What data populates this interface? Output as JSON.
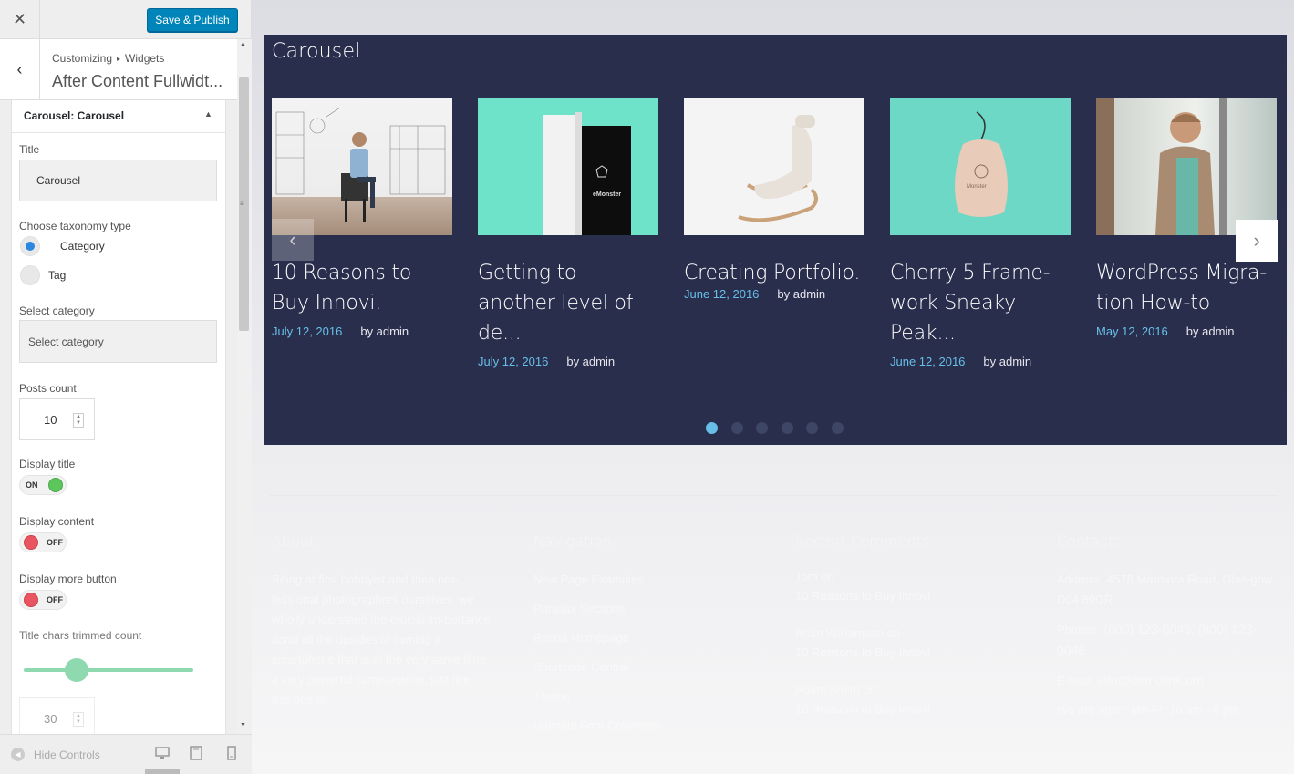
{
  "sidebar": {
    "close_icon": "✕",
    "save_label": "Save & Publish",
    "back_icon": "‹",
    "breadcrumb": [
      "Customizing",
      "Widgets"
    ],
    "breadcrumb_sep": "▸",
    "section_title": "After Content Fullwidt...",
    "widget": {
      "title": "Carousel: Carousel",
      "title_value": "Carousel",
      "title_label": "Title",
      "taxonomy_label": "Choose taxonomy type",
      "taxonomy_options": [
        "Category",
        "Tag"
      ],
      "taxonomy_selected": "Category",
      "category_label": "Select category",
      "category_placeholder": "Select category",
      "posts_count_label": "Posts count",
      "posts_count": "10",
      "display_title_label": "Display title",
      "display_title_state": "ON",
      "display_content_label": "Display content",
      "display_content_state": "OFF",
      "display_more_label": "Display more button",
      "display_more_state": "OFF",
      "trim_label": "Title chars trimmed count",
      "trim_value": "30",
      "trim_slider_fraction": 0.3
    },
    "footer": {
      "hide_controls": "Hide Controls",
      "devices": [
        "desktop-icon",
        "tablet-icon",
        "mobile-icon"
      ]
    }
  },
  "preview": {
    "carousel_title": "Carousel",
    "posts": [
      {
        "title": "10 Reasons to Buy Innovi.",
        "date": "July 12, 2016",
        "author": "by admin",
        "image": "man-sitting-chair"
      },
      {
        "title": "Getting to another level of de...",
        "date": "July 12, 2016",
        "author": "by admin",
        "image": "tablet-mint"
      },
      {
        "title": "Creating Portfolio.",
        "date": "June 12, 2016",
        "author": "by admin",
        "image": "lounge-chair"
      },
      {
        "title": "Cherry 5 Frame-work Sneaky Peak...",
        "date": "June 12, 2016",
        "author": "by admin",
        "image": "pouch-bag"
      },
      {
        "title": "WordPress Migra-tion How-to",
        "date": "May 12, 2016",
        "author": "by admin",
        "image": "man-glasses"
      }
    ],
    "tablet_text": "eMonster",
    "pouch_text": "Monster",
    "dots": 6,
    "active_dot": 0,
    "footer": {
      "about_title": "About",
      "about_text": "Being at first hobbyist and then pro-fessional photographers ourselves, we wholly understand the crucial im-portance aond all the upsides of owning a smartphone that is at the very same time a very powerful cumeraquine, just like this one is!",
      "nav_title": "Navigation",
      "nav_items": [
        "New Page Examples",
        "Parallax Sections",
        "Retina Homepage",
        "Shortcode Central",
        "Theme",
        "Ultimate Font Collection"
      ],
      "comments_title": "Recent Comments",
      "comments": [
        {
          "who": "Tom  on",
          "post": "10 Reasons to Buy Innovi"
        },
        {
          "who": "Brian Williamson  on",
          "post": "10 Reasons to Buy Innovi"
        },
        {
          "who": "Adam Smith  on",
          "post": "10 Reasons to Buy Innovi"
        }
      ],
      "contacts_title": "Contacts",
      "address": "Address: 4578 Marmora Road, Glas-gow, D04 89GR",
      "phones_label": "Phones:",
      "phones": "(800) 123-0045; (800) 123-0046",
      "email_label": "E-mail:",
      "email": "info@demolink.org",
      "hours": "We are open: Mn-Fr: 10 am - 8 pm"
    }
  }
}
